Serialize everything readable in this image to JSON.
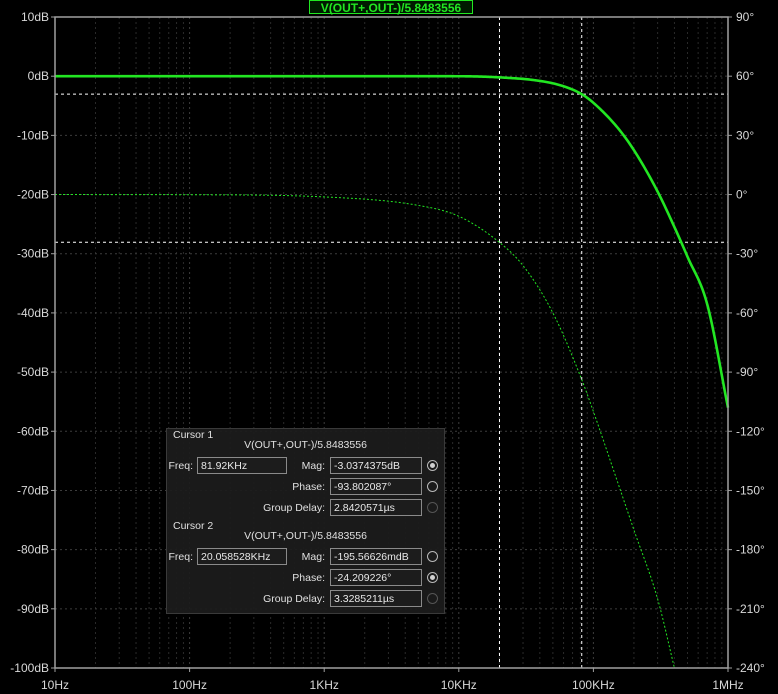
{
  "trace_title": "V(OUT+,OUT-)/5.8483556",
  "chart_data": {
    "type": "line",
    "x_axis": {
      "scale": "log",
      "range_hz": [
        10,
        1000000
      ],
      "tick_labels": [
        "10Hz",
        "100Hz",
        "1KHz",
        "10KHz",
        "100KHz",
        "1MHz"
      ]
    },
    "y_left": {
      "unit": "dB",
      "range": [
        -100,
        10
      ],
      "tick_labels": [
        "10dB",
        "0dB",
        "-10dB",
        "-20dB",
        "-30dB",
        "-40dB",
        "-50dB",
        "-60dB",
        "-70dB",
        "-80dB",
        "-90dB",
        "-100dB"
      ]
    },
    "y_right": {
      "unit": "degrees",
      "range": [
        -240,
        90
      ],
      "tick_labels": [
        "90°",
        "60°",
        "30°",
        "0°",
        "-30°",
        "-60°",
        "-90°",
        "-120°",
        "-150°",
        "-180°",
        "-210°",
        "-240°"
      ]
    },
    "grid": true,
    "series": [
      {
        "name": "V(OUT+,OUT-)/5.8483556",
        "kind": "magnitude",
        "color": "#22e622",
        "style": "solid",
        "x": [
          10,
          1000,
          10000,
          20000,
          40000,
          60000,
          81920,
          100000,
          150000,
          200000,
          300000,
          400000,
          500000,
          700000,
          1000000
        ],
        "y": [
          0,
          0,
          -0.01,
          -0.2,
          -0.8,
          -1.7,
          -3.04,
          -4.5,
          -8.6,
          -12.5,
          -19.5,
          -25.5,
          -30.5,
          -38.5,
          -56
        ]
      },
      {
        "name": "V(OUT+,OUT-)/5.8483556",
        "kind": "phase",
        "color": "#22e622",
        "style": "dashed",
        "x": [
          10,
          100,
          1000,
          5000,
          10000,
          20000,
          30000,
          50000,
          81920,
          100000,
          150000,
          200000,
          300000,
          400000
        ],
        "y": [
          0,
          -0.1,
          -1.2,
          -5.5,
          -11,
          -24.2,
          -36,
          -60,
          -93.8,
          -110,
          -145,
          -170,
          -205,
          -240
        ]
      }
    ],
    "cursors": [
      {
        "id": 1,
        "freq_hz": 81920,
        "mag_db": -3.0374375
      },
      {
        "id": 2,
        "freq_hz": 20058.528,
        "phase_deg": -24.209226
      }
    ]
  },
  "cursor_panel": {
    "cursor1": {
      "title": "Cursor 1",
      "expr": "V(OUT+,OUT-)/5.8483556",
      "freq_label": "Freq:",
      "freq": "81.92KHz",
      "mag_label": "Mag:",
      "mag": "-3.0374375dB",
      "phase_label": "Phase:",
      "phase": "-93.802087°",
      "gd_label": "Group Delay:",
      "gd": "2.8420571µs"
    },
    "cursor2": {
      "title": "Cursor 2",
      "expr": "V(OUT+,OUT-)/5.8483556",
      "freq_label": "Freq:",
      "freq": "20.058528KHz",
      "mag_label": "Mag:",
      "mag": "-195.56626mdB",
      "phase_label": "Phase:",
      "phase": "-24.209226°",
      "gd_label": "Group Delay:",
      "gd": "3.3285211µs"
    }
  }
}
